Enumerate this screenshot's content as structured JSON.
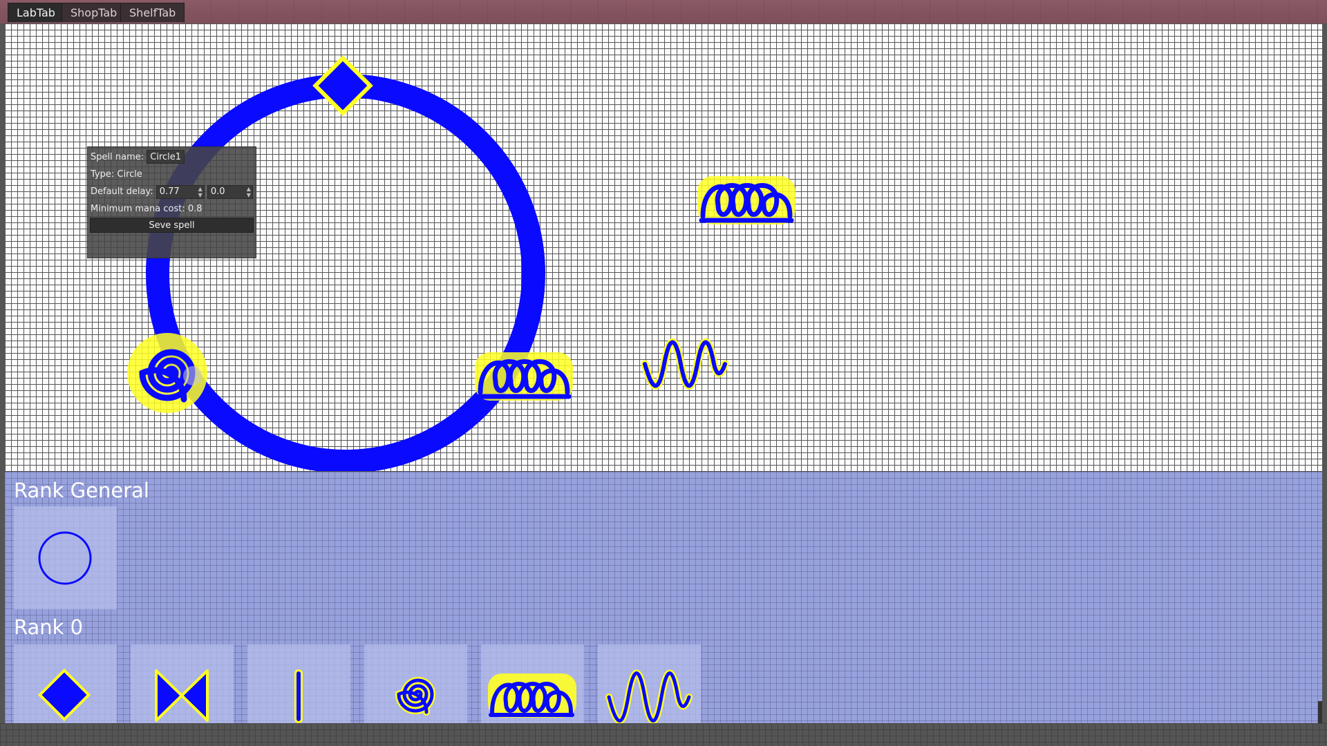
{
  "tabs": [
    {
      "label": "LabTab",
      "active": true
    },
    {
      "label": "ShopTab",
      "active": false
    },
    {
      "label": "ShelfTab",
      "active": false
    }
  ],
  "spell_panel": {
    "name_label": "Spell name:",
    "name_value": "Circle1",
    "type_label": "Type:",
    "type_value": "Circle",
    "delay_label": "Default delay:",
    "delay_value_1": "0.77",
    "delay_value_2": "0.0",
    "mana_label": "Minimum mana cost:",
    "mana_value": "0.8",
    "save_label": "Seve spell"
  },
  "palette": {
    "rank_general_title": "Rank General",
    "rank_general_items": [
      "circle-rune"
    ],
    "rank0_title": "Rank 0",
    "rank0_items": [
      "diamond-rune",
      "bowtie-rune",
      "line-rune",
      "spiral-rune",
      "coil-rune",
      "wave-rune"
    ]
  },
  "colors": {
    "rune_blue": "#0a0aff",
    "rune_glow": "#ffff22",
    "palette_bg": "#97a1dc",
    "tabbar_bg": "#7d4f5b"
  }
}
